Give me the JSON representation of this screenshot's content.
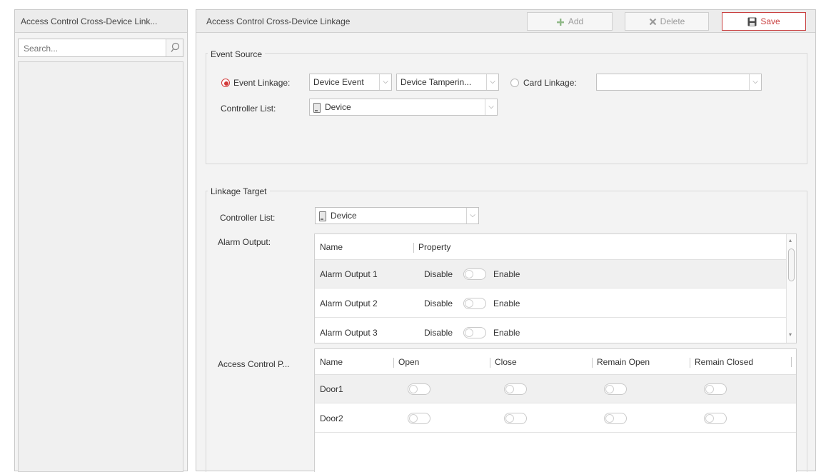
{
  "left_panel": {
    "title": "Access Control Cross-Device Link...",
    "search_placeholder": "Search..."
  },
  "main_panel": {
    "title": "Access Control Cross-Device Linkage",
    "toolbar": {
      "add_label": "Add",
      "delete_label": "Delete",
      "save_label": "Save"
    }
  },
  "event_source": {
    "legend": "Event Source",
    "event_linkage_label": "Event Linkage:",
    "event_type": "Device Event",
    "event_subtype": "Device Tamperin...",
    "card_linkage_label": "Card Linkage:",
    "card_linkage_value": "",
    "controller_list_label": "Controller List:",
    "controller_value": "Device"
  },
  "linkage_target": {
    "legend": "Linkage Target",
    "controller_list_label": "Controller List:",
    "controller_value": "Device",
    "alarm_output_label": "Alarm Output:",
    "alarm_table": {
      "headers": [
        "Name",
        "Property"
      ],
      "rows": [
        {
          "name": "Alarm Output 1",
          "disable": "Disable",
          "enable": "Enable"
        },
        {
          "name": "Alarm Output 2",
          "disable": "Disable",
          "enable": "Enable"
        },
        {
          "name": "Alarm Output 3",
          "disable": "Disable",
          "enable": "Enable"
        }
      ]
    },
    "access_control_label": "Access Control P...",
    "door_table": {
      "headers": [
        "Name",
        "Open",
        "Close",
        "Remain Open",
        "Remain Closed"
      ],
      "rows": [
        {
          "name": "Door1"
        },
        {
          "name": "Door2"
        }
      ]
    }
  },
  "colors": {
    "accent": "#d23a3a",
    "panel_bg": "#f3f3f3",
    "border": "#c8c8c8"
  }
}
